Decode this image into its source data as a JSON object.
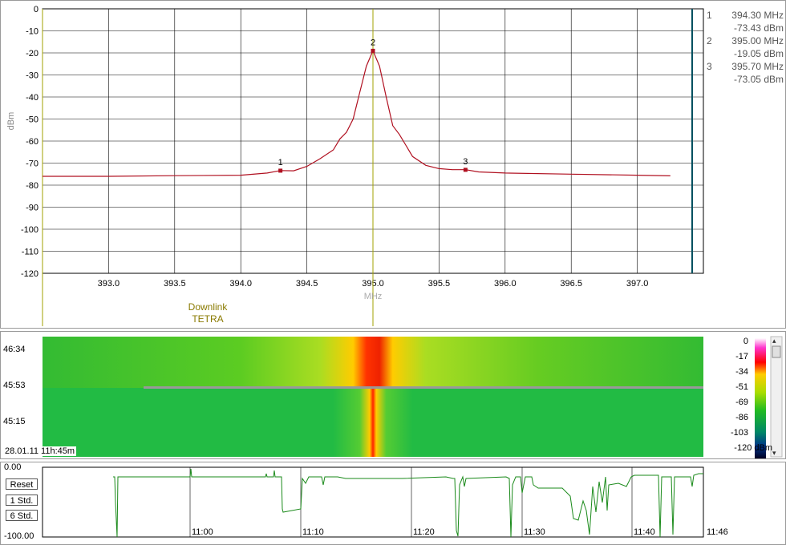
{
  "spectrum": {
    "ylabel": "dBm",
    "xlabel": "MHz",
    "band_label_line1": "Downlink",
    "band_label_line2": "TETRA"
  },
  "markers": [
    {
      "id": "1",
      "freq": "394.30 MHz",
      "level": "-73.43 dBm"
    },
    {
      "id": "2",
      "freq": "395.00 MHz",
      "level": "-19.05 dBm"
    },
    {
      "id": "3",
      "freq": "395.70 MHz",
      "level": "-73.05 dBm"
    }
  ],
  "waterfall": {
    "times": [
      "46:34",
      "45:53",
      "45:15"
    ],
    "timestamp": "28.01.11 11h:45m",
    "colorbar_labels": [
      "0",
      "-17",
      "-34",
      "-51",
      "-69",
      "-86",
      "-103",
      "-120 dBm"
    ]
  },
  "history": {
    "ytop": "0.00",
    "ybottom": "-100.00",
    "buttons": [
      "Reset",
      "1 Std.",
      "6 Std."
    ],
    "time_labels": [
      "11:00",
      "11:10",
      "11:20",
      "11:30",
      "11:40",
      "11:46"
    ]
  },
  "colors": {
    "trace": "#b01020",
    "center_line": "#a0a000",
    "history_trace": "#1a8a1a",
    "end_line": "#005060"
  },
  "chart_data": [
    {
      "type": "line",
      "title": "",
      "xlabel": "MHz",
      "ylabel": "dBm",
      "xlim": [
        392.5,
        397.5
      ],
      "ylim": [
        -120,
        0
      ],
      "x_ticks": [
        393.0,
        393.5,
        394.0,
        394.5,
        395.0,
        395.5,
        396.0,
        396.5,
        397.0
      ],
      "y_ticks": [
        0,
        -10,
        -20,
        -30,
        -40,
        -50,
        -60,
        -70,
        -80,
        -90,
        -100,
        -110,
        -120
      ],
      "grid": true,
      "series": [
        {
          "x": [
            392.5,
            393.0,
            393.5,
            394.0,
            394.2,
            394.3,
            394.4,
            394.5,
            394.6,
            394.7,
            394.75,
            394.8,
            394.85,
            394.9,
            394.95,
            395.0,
            395.05,
            395.1,
            395.15,
            395.2,
            395.25,
            395.3,
            395.4,
            395.5,
            395.6,
            395.7,
            395.8,
            396.0,
            396.5,
            397.0,
            397.25
          ],
          "y": [
            -76,
            -76,
            -75.7,
            -75.5,
            -74.5,
            -73.4,
            -73.5,
            -71.5,
            -68,
            -64,
            -59,
            -56,
            -50,
            -38,
            -26,
            -19,
            -26,
            -40,
            -53,
            -57,
            -62,
            -67,
            -71,
            -72.5,
            -73,
            -73,
            -74,
            -74.5,
            -75,
            -75.5,
            -75.8
          ]
        }
      ],
      "markers": [
        {
          "label": "1",
          "x": 394.3,
          "y": -73.43
        },
        {
          "label": "2",
          "x": 395.0,
          "y": -19.05
        },
        {
          "label": "3",
          "x": 395.7,
          "y": -73.05
        }
      ]
    }
  ]
}
